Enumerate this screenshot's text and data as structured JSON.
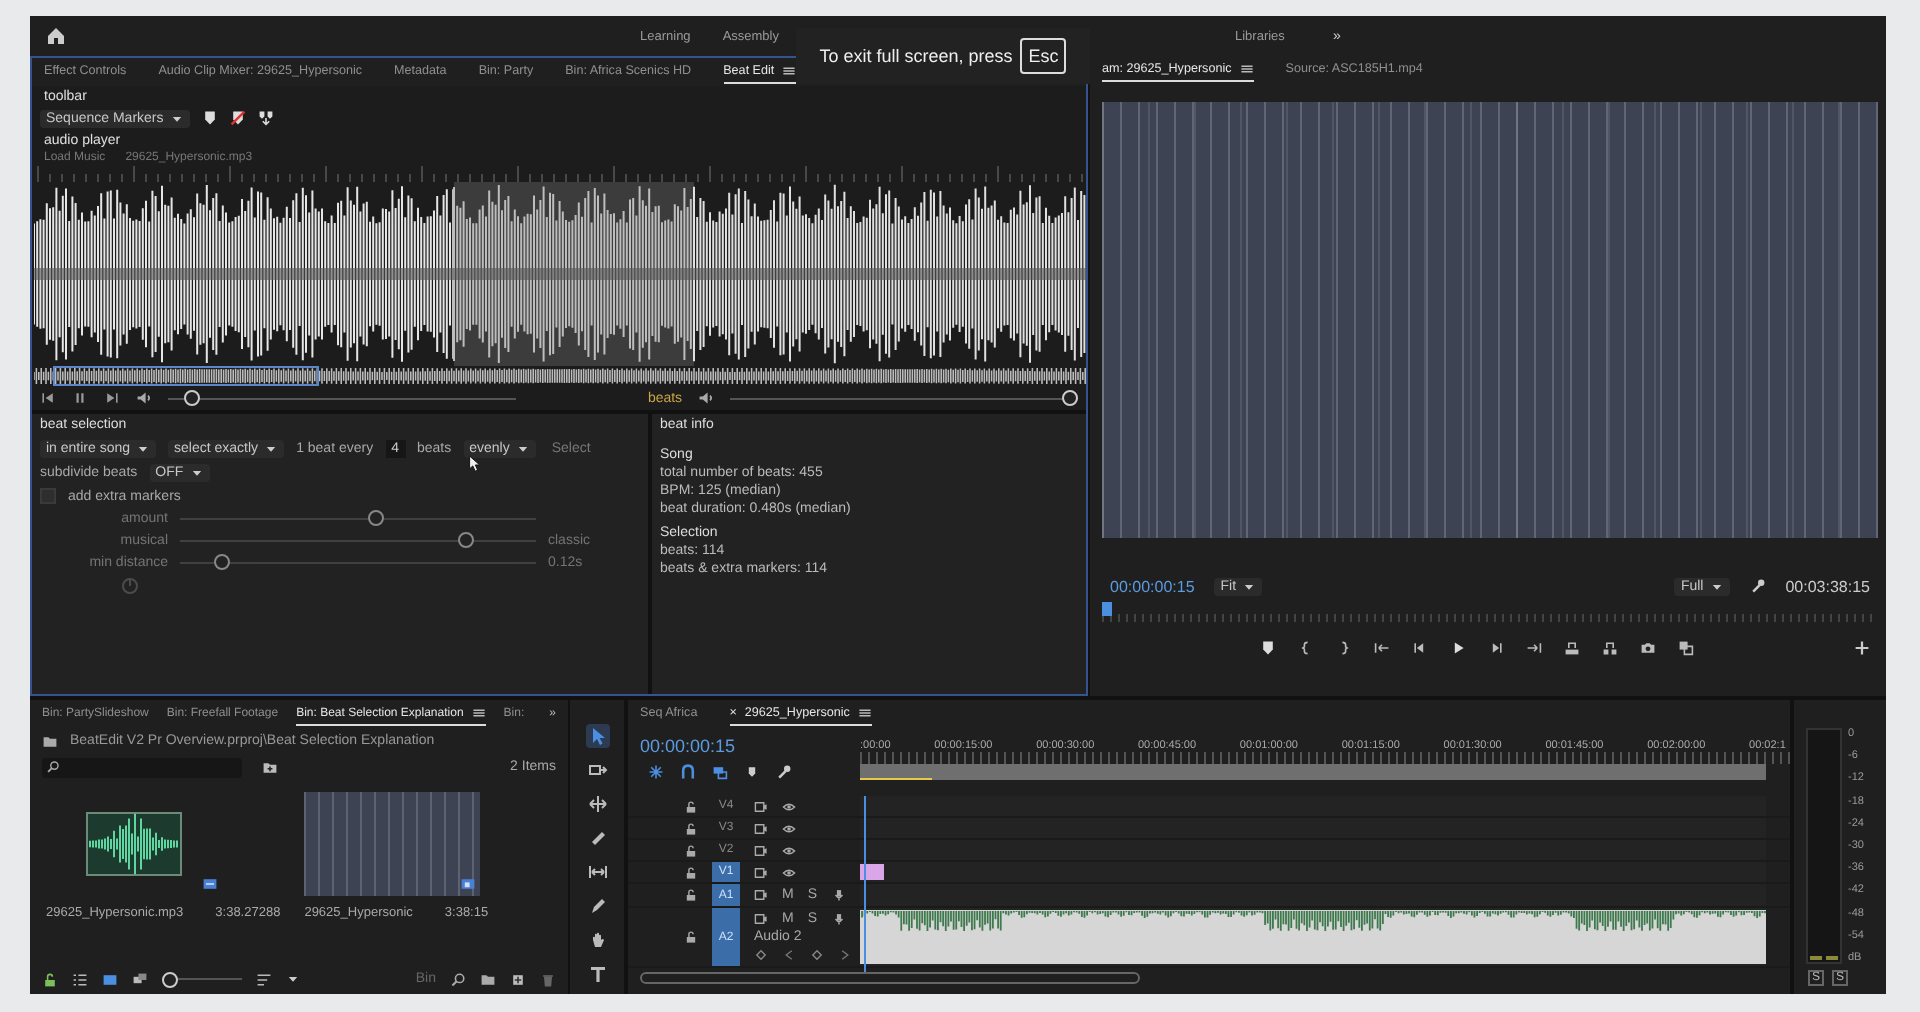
{
  "workspace_bar": {
    "tabs": [
      {
        "label": "Learning",
        "selected": false
      },
      {
        "label": "Assembly",
        "selected": false
      },
      {
        "label": "Libraries",
        "selected": false
      }
    ],
    "more": "»"
  },
  "fullscreen_notice": {
    "text": "To exit full screen, press",
    "key": "Esc"
  },
  "beat_edit": {
    "tabs": [
      {
        "label": "Effect Controls",
        "selected": false
      },
      {
        "label": "Audio Clip Mixer: 29625_Hypersonic",
        "selected": false
      },
      {
        "label": "Metadata",
        "selected": false
      },
      {
        "label": "Bin: Party",
        "selected": false
      },
      {
        "label": "Bin: Africa Scenics HD",
        "selected": false
      },
      {
        "label": "Beat Edit",
        "selected": true
      }
    ],
    "toolbar": {
      "title": "toolbar",
      "marker_type": "Sequence Markers"
    },
    "audio_player": {
      "title": "audio player",
      "load_label": "Load Music",
      "file": "29625_Hypersonic.mp3",
      "seek": {
        "level": 0.05
      },
      "beats_label": "beats",
      "beats_volume": {
        "level": 1.0
      }
    },
    "beat_selection": {
      "title": "beat selection",
      "range": "in entire song",
      "mode": "select exactly",
      "every_prefix": "1 beat every",
      "every_value": "4",
      "every_suffix": "beats",
      "distribution": "evenly",
      "select_button": "Select",
      "subdivide_label": "subdivide beats",
      "subdivide": "OFF",
      "extra_markers": {
        "label": "add extra markers",
        "checked": false
      },
      "extra_settings": [
        {
          "label": "amount",
          "level": 0.55,
          "disabled": true
        },
        {
          "label": "musical",
          "level": 0.82,
          "reading": "classic",
          "disabled": true
        },
        {
          "label": "min distance",
          "level": 0.1,
          "reading": "0.12s",
          "disabled": true
        }
      ]
    },
    "beat_info": {
      "title": "beat info",
      "sections": [
        {
          "heading": "Song",
          "lines": [
            "total number of beats: 455",
            "BPM: 125 (median)",
            "beat duration: 0.480s (median)"
          ]
        },
        {
          "heading": "Selection",
          "lines": [
            "beats: 114",
            "beats & extra markers: 114"
          ]
        }
      ]
    }
  },
  "program_monitor": {
    "tabs": [
      {
        "label": "am: 29625_Hypersonic",
        "selected": true
      },
      {
        "label": "Source: ASC185H1.mp4",
        "selected": false
      }
    ],
    "timecode": "00:00:00:15",
    "zoom": "Fit",
    "resolution": "Full",
    "duration": "00:03:38:15",
    "scrubber": {
      "level": 0.0
    }
  },
  "project_bin": {
    "tabs": [
      {
        "label": "Bin: PartySlideshow",
        "selected": false
      },
      {
        "label": "Bin: Freefall Footage",
        "selected": false
      },
      {
        "label": "Bin: Beat Selection Explanation",
        "selected": true
      },
      {
        "label": "Bin:",
        "selected": false
      }
    ],
    "more": "»",
    "path": "BeatEdit V2 Pr Overview.prproj\\Beat Selection Explanation",
    "item_count": "2 Items",
    "items": [
      {
        "kind": "audio",
        "name": "29625_Hypersonic.mp3",
        "duration": "3:38.27288"
      },
      {
        "kind": "video",
        "name": "29625_Hypersonic",
        "duration": "3:38:15"
      }
    ],
    "footer_label": "Bin",
    "zoom": {
      "level": 0.0
    }
  },
  "tools": [
    {
      "kind": "selection",
      "selected": true
    },
    {
      "kind": "track_select",
      "selected": false
    },
    {
      "kind": "ripple",
      "selected": false
    },
    {
      "kind": "razor",
      "selected": false
    },
    {
      "kind": "slip",
      "selected": false
    },
    {
      "kind": "pen",
      "selected": false
    },
    {
      "kind": "hand",
      "selected": false
    },
    {
      "kind": "type",
      "selected": false
    }
  ],
  "timeline": {
    "tabs": [
      {
        "label": "Seq Africa",
        "selected": false
      },
      {
        "label": "29625_Hypersonic",
        "selected": true,
        "close": "×"
      }
    ],
    "timecode": "00:00:00:15",
    "ruler": [
      ":00:00",
      "00:00:15:00",
      "00:00:30:00",
      "00:00:45:00",
      "00:01:00:00",
      "00:01:15:00",
      "00:01:30:00",
      "00:01:45:00",
      "00:02:00:00",
      "00:02:1"
    ],
    "tracks": [
      {
        "label": "V4",
        "kind": "video",
        "targeted": false
      },
      {
        "label": "V3",
        "kind": "video",
        "targeted": false
      },
      {
        "label": "V2",
        "kind": "video",
        "targeted": false
      },
      {
        "label": "V1",
        "kind": "video",
        "targeted": true,
        "clip": {
          "color": "#d9a6e8"
        }
      },
      {
        "label": "A1",
        "kind": "audio",
        "targeted": true,
        "buttons": [
          "M",
          "S"
        ]
      },
      {
        "label": "A2",
        "kind": "audio_expanded",
        "targeted": true,
        "buttons": [
          "M",
          "S"
        ],
        "name": "Audio 2",
        "clip": {
          "color": "#d6d6d6"
        }
      }
    ]
  },
  "audio_meter": {
    "scale": [
      "0",
      "-6",
      "-12",
      "-18",
      "-24",
      "-30",
      "-36",
      "-42",
      "-48",
      "-54",
      "dB"
    ],
    "solo_buttons": [
      "S",
      "S"
    ]
  }
}
